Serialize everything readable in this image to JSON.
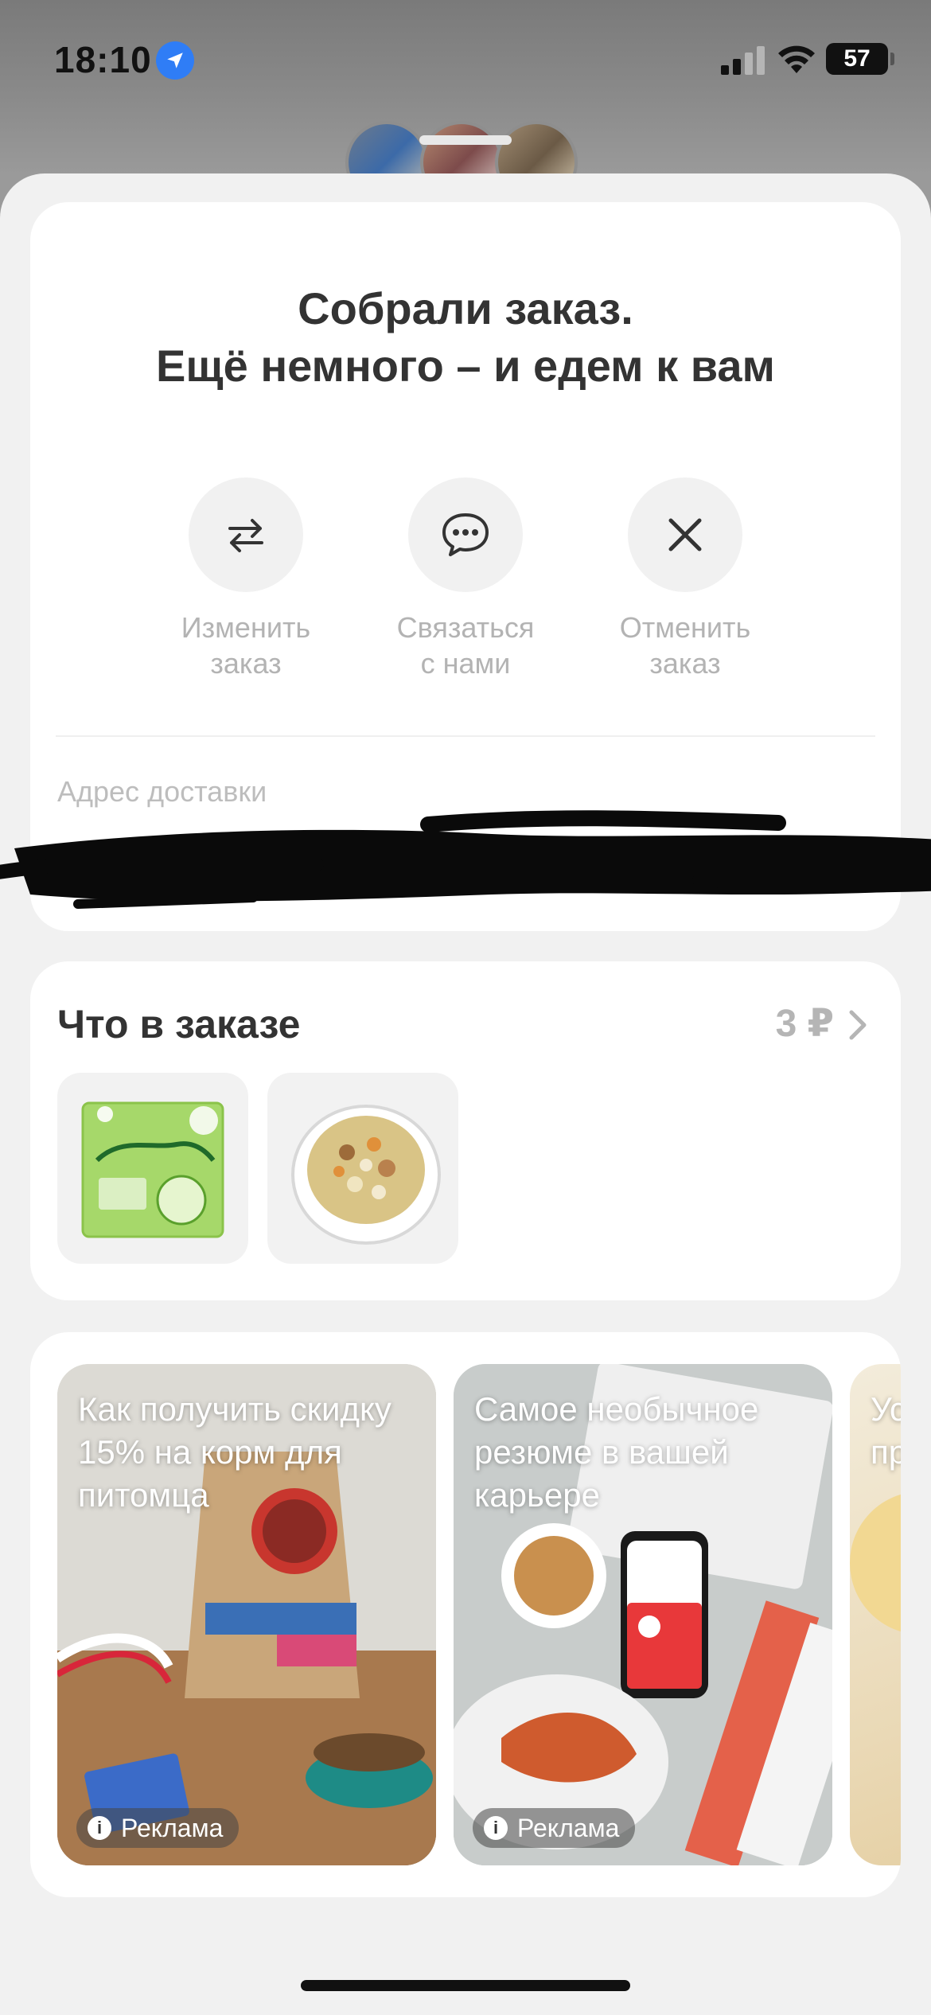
{
  "status_bar": {
    "time": "18:10",
    "battery": "57"
  },
  "order_status": {
    "title_line1": "Собрали заказ.",
    "title_line2": "Ещё немного – и едем к вам"
  },
  "actions": [
    {
      "label": "Изменить\nзаказ",
      "icon": "swap-arrows-icon"
    },
    {
      "label": "Связаться\nс нами",
      "icon": "chat-bubble-icon"
    },
    {
      "label": "Отменить\nзаказ",
      "icon": "close-icon"
    }
  ],
  "address": {
    "label": "Адрес доставки"
  },
  "order_summary": {
    "title": "Что в заказе",
    "price": "3 ₽"
  },
  "promos": [
    {
      "title": "Как получить скидку 15% на корм для питомца",
      "badge": "Реклама"
    },
    {
      "title": "Самое необычное резюме в вашей карьере",
      "badge": "Реклама"
    },
    {
      "title": "Ус пр",
      "badge": ""
    }
  ],
  "colors": {
    "accent_location": "#2f7df6",
    "text_primary": "#333333",
    "text_muted": "#b3b3b3",
    "sheet_bg": "#f1f1f1"
  }
}
